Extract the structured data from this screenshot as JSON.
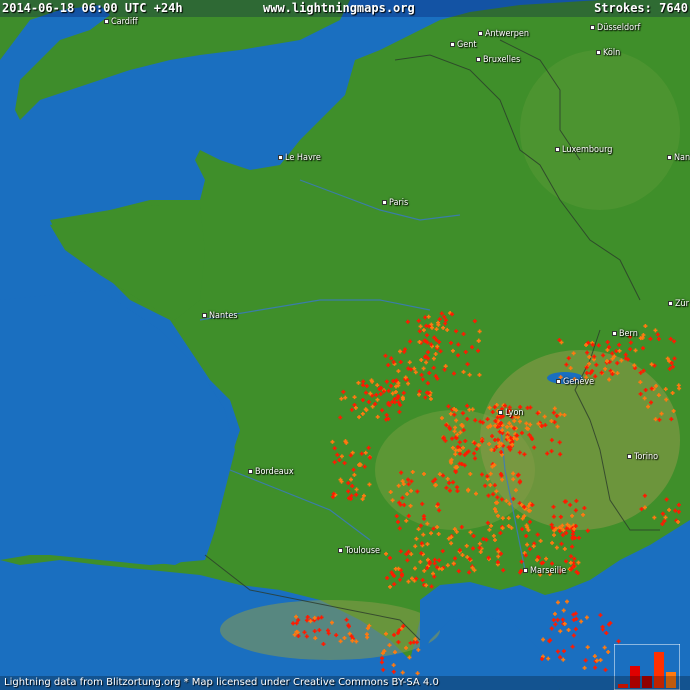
{
  "header": {
    "timestamp": "2014-06-18 06:00 UTC +24h",
    "site": "www.lightningmaps.org",
    "strokes_label": "Strokes: 7640"
  },
  "footer": {
    "credit": "Lightning data from Blitzortung.org  *  Map licensed under Creative Commons BY-SA 4.0"
  },
  "colors": {
    "sea": "#1a6fc0",
    "land": "#3f8f2a",
    "recent_strike": "#ff1a00",
    "older_strike": "#ff7a10"
  },
  "cities": [
    {
      "name": "Gent"
    },
    {
      "name": "Antwerpen"
    },
    {
      "name": "Bruxelles"
    },
    {
      "name": "Köln"
    },
    {
      "name": "Luxembourg"
    },
    {
      "name": "Le Havre"
    },
    {
      "name": "Paris"
    },
    {
      "name": "Nantes"
    },
    {
      "name": "Bern"
    },
    {
      "name": "Genève"
    },
    {
      "name": "Lyon"
    },
    {
      "name": "Bordeaux"
    },
    {
      "name": "Torino"
    },
    {
      "name": "Toulouse"
    },
    {
      "name": "Marseille"
    },
    {
      "name": "Zür"
    },
    {
      "name": "Nanc"
    },
    {
      "name": "Cardiff"
    },
    {
      "name": "Düsseldorf"
    }
  ],
  "legend": {
    "bar_fractions": [
      0.1,
      0.55,
      0.3,
      0.9,
      0.4
    ]
  }
}
